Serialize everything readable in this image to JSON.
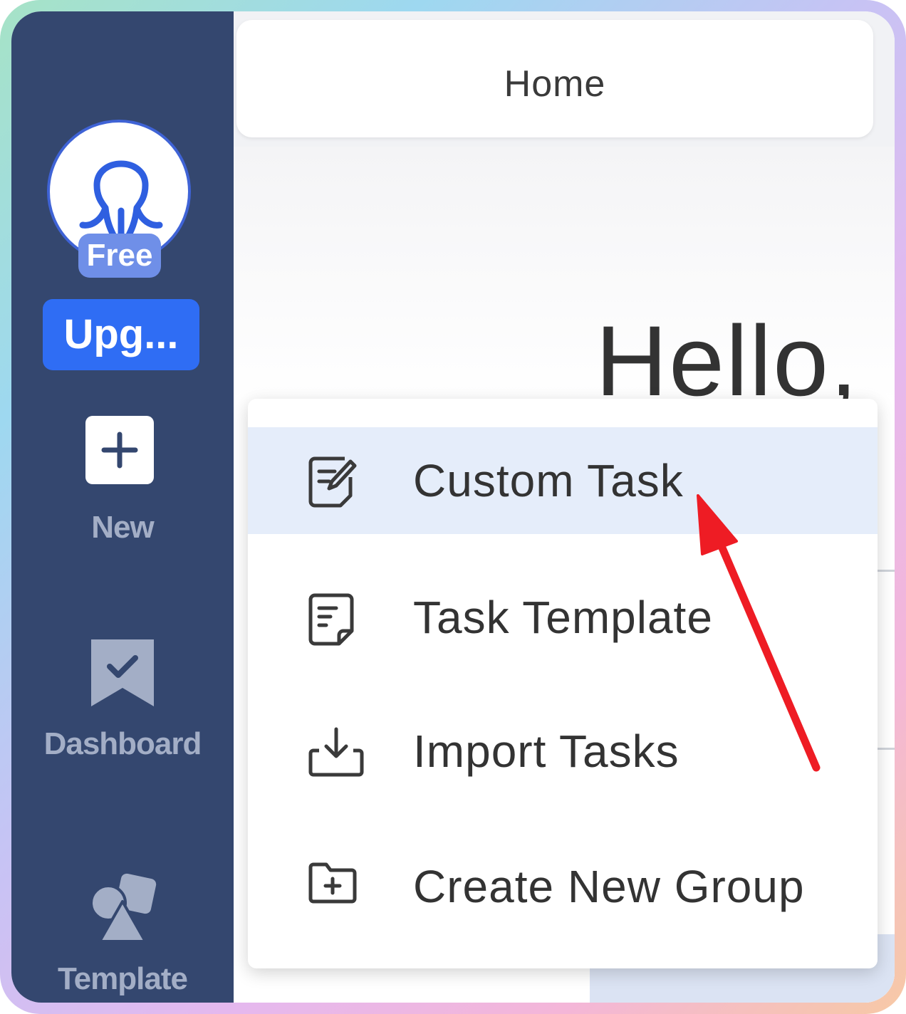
{
  "sidebar": {
    "badge": "Free",
    "upgrade_label": "Upg...",
    "items": [
      {
        "label": "New",
        "icon": "plus-icon"
      },
      {
        "label": "Dashboard",
        "icon": "bookmark-check-icon"
      },
      {
        "label": "Template",
        "icon": "shapes-icon"
      }
    ]
  },
  "header": {
    "tab_title": "Home"
  },
  "main": {
    "greeting": "Hello,"
  },
  "menu": {
    "items": [
      {
        "label": "Custom Task",
        "icon": "edit-document-icon",
        "active": true
      },
      {
        "label": "Task Template",
        "icon": "document-list-icon",
        "active": false
      },
      {
        "label": "Import Tasks",
        "icon": "import-tray-icon",
        "active": false
      },
      {
        "label": "Create New Group",
        "icon": "folder-plus-icon",
        "active": false
      }
    ]
  },
  "colors": {
    "sidebar_bg": "#34476f",
    "upgrade_bg": "#2f6df4",
    "menu_active_bg": "#e5edfa",
    "annotation_arrow": "#ee1c24"
  }
}
